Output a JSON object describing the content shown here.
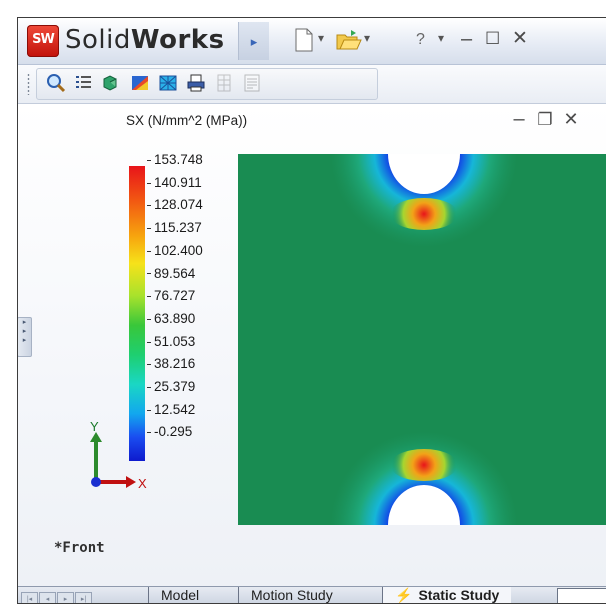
{
  "app": {
    "logo_text": "SW",
    "brand_regular": "Solid",
    "brand_bold": "Works",
    "title_icons": [
      "new-document-icon",
      "open-folder-icon",
      "help-icon",
      "minimize-icon",
      "maximize-icon",
      "close-icon"
    ]
  },
  "toolbar": {
    "tools": [
      "zoom-icon",
      "list-icon",
      "parts-icon",
      "results-icon",
      "mesh-icon",
      "print-icon",
      "grid-icon",
      "report-icon"
    ]
  },
  "viewport": {
    "plot_title": "SX (N/mm^2 (MPa))",
    "view_name": "*Front",
    "axis_y": "Y",
    "axis_x": "X",
    "colors": {
      "field": "#198c52",
      "low": "#0e1acd",
      "high": "#e8141a"
    }
  },
  "legend": {
    "values": [
      "153.748",
      "140.911",
      "128.074",
      "115.237",
      "102.400",
      "89.564",
      "76.727",
      "63.890",
      "51.053",
      "38.216",
      "25.379",
      "12.542",
      "-0.295"
    ]
  },
  "tabs": {
    "model": "Model",
    "motion": "Motion Study",
    "static": "Static Study",
    "static_icon": "static-study-icon"
  }
}
